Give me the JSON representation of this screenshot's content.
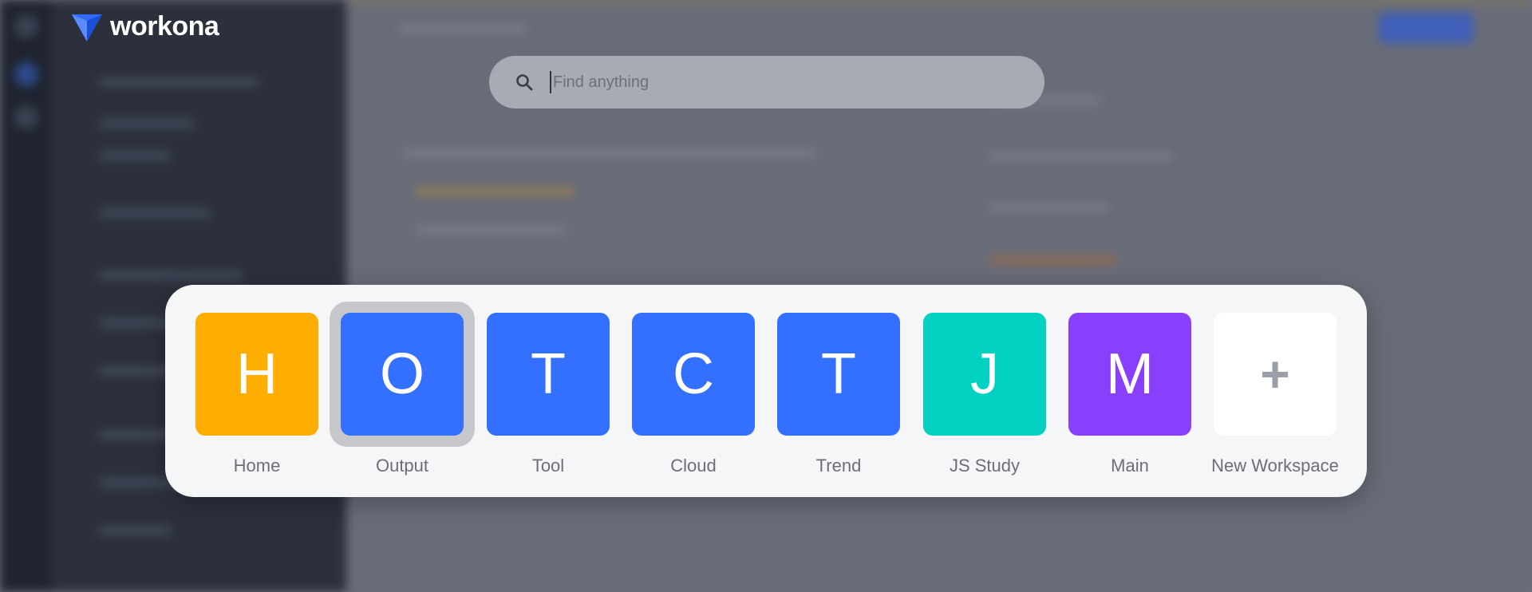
{
  "app": {
    "name": "workona"
  },
  "search": {
    "placeholder": "Find anything",
    "value": ""
  },
  "workspaces": [
    {
      "letter": "H",
      "label": "Home",
      "color": "#FFAD00",
      "selected": false
    },
    {
      "letter": "O",
      "label": "Output",
      "color": "#3370FF",
      "selected": true
    },
    {
      "letter": "T",
      "label": "Tool",
      "color": "#3370FF",
      "selected": false
    },
    {
      "letter": "C",
      "label": "Cloud",
      "color": "#3370FF",
      "selected": false
    },
    {
      "letter": "T",
      "label": "Trend",
      "color": "#3370FF",
      "selected": false
    },
    {
      "letter": "J",
      "label": "JS Study",
      "color": "#00D1C1",
      "selected": false
    },
    {
      "letter": "M",
      "label": "Main",
      "color": "#8A3FFC",
      "selected": false
    }
  ],
  "new_workspace": {
    "symbol": "+",
    "label": "New Workspace"
  }
}
